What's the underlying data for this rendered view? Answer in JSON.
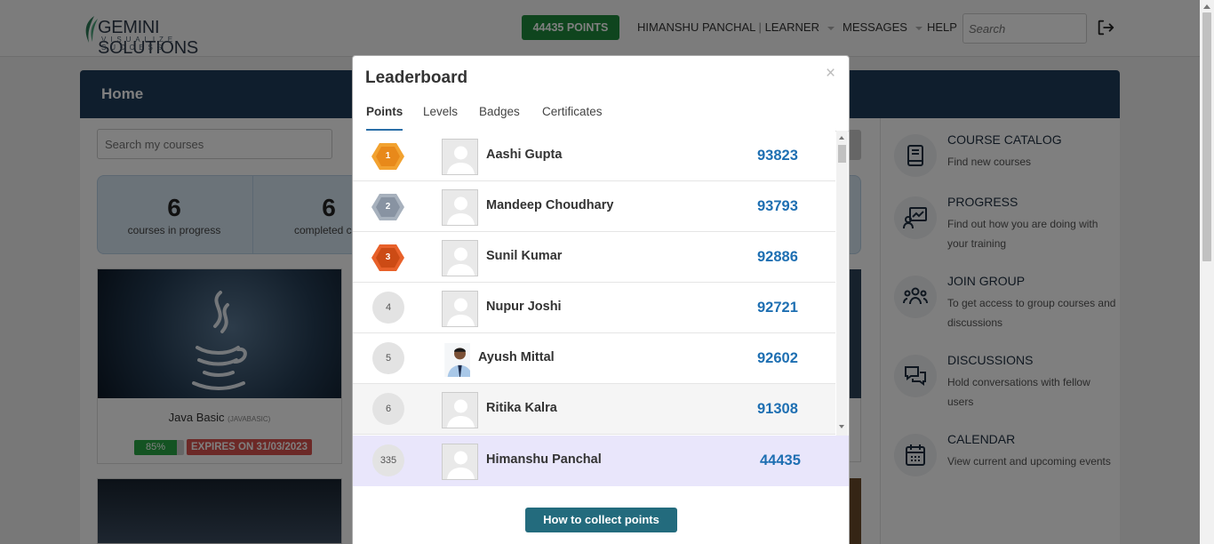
{
  "topbar": {
    "logo_brand": "GEMINI SOLUTIONS",
    "logo_tagline": "VISUALIZE SUCCESS",
    "points_button": "44435 POINTS",
    "user_name": "HIMANSHU PANCHAL",
    "user_separator": "|",
    "user_role": "LEARNER",
    "messages": "MESSAGES",
    "help": "HELP",
    "search_placeholder": "Search",
    "logout_icon": "logout-icon",
    "brand_color": "#1f8b3c"
  },
  "home": {
    "title": "Home",
    "search_placeholder": "Search my courses",
    "header_color": "#1f3c5a",
    "stats": [
      {
        "value": "6",
        "label": "courses in progress"
      },
      {
        "value": "6",
        "label": "completed cou"
      }
    ],
    "course": {
      "title": "Java Basic",
      "code": "(JAVABASIC)",
      "progress_label": "85%",
      "progress": 0.85,
      "expires": "EXPIRES ON 31/03/2023"
    }
  },
  "sidebar": {
    "items": [
      {
        "title": "COURSE CATALOG",
        "desc": "Find new courses",
        "icon": "book-icon"
      },
      {
        "title": "PROGRESS",
        "desc": "Find out how you are doing with your training",
        "icon": "progress-chart-icon"
      },
      {
        "title": "JOIN GROUP",
        "desc": "To get access to group courses and discussions",
        "icon": "group-icon"
      },
      {
        "title": "DISCUSSIONS",
        "desc": "Hold conversations with fellow users",
        "icon": "chat-icon"
      },
      {
        "title": "CALENDAR",
        "desc": "View current and upcoming events",
        "icon": "calendar-icon"
      }
    ]
  },
  "leaderboard": {
    "title": "Leaderboard",
    "close": "×",
    "tabs": [
      "Points",
      "Levels",
      "Badges",
      "Certificates"
    ],
    "active_tab": "Points",
    "rows": [
      {
        "rank": "1",
        "name": "Aashi Gupta",
        "points": "93823",
        "medal": "gold"
      },
      {
        "rank": "2",
        "name": "Mandeep Choudhary",
        "points": "93793",
        "medal": "silver"
      },
      {
        "rank": "3",
        "name": "Sunil Kumar",
        "points": "92886",
        "medal": "bronze"
      },
      {
        "rank": "4",
        "name": "Nupur Joshi",
        "points": "92721"
      },
      {
        "rank": "5",
        "name": "Ayush Mittal",
        "points": "92602"
      },
      {
        "rank": "6",
        "name": "Ritika Kalra",
        "points": "91308"
      }
    ],
    "current_user": {
      "rank": "335",
      "name": "Himanshu Panchal",
      "points": "44435"
    },
    "collect_button": "How to collect points",
    "accent_color": "#1e6fb2",
    "highlight_color": "#e9e6fb"
  }
}
